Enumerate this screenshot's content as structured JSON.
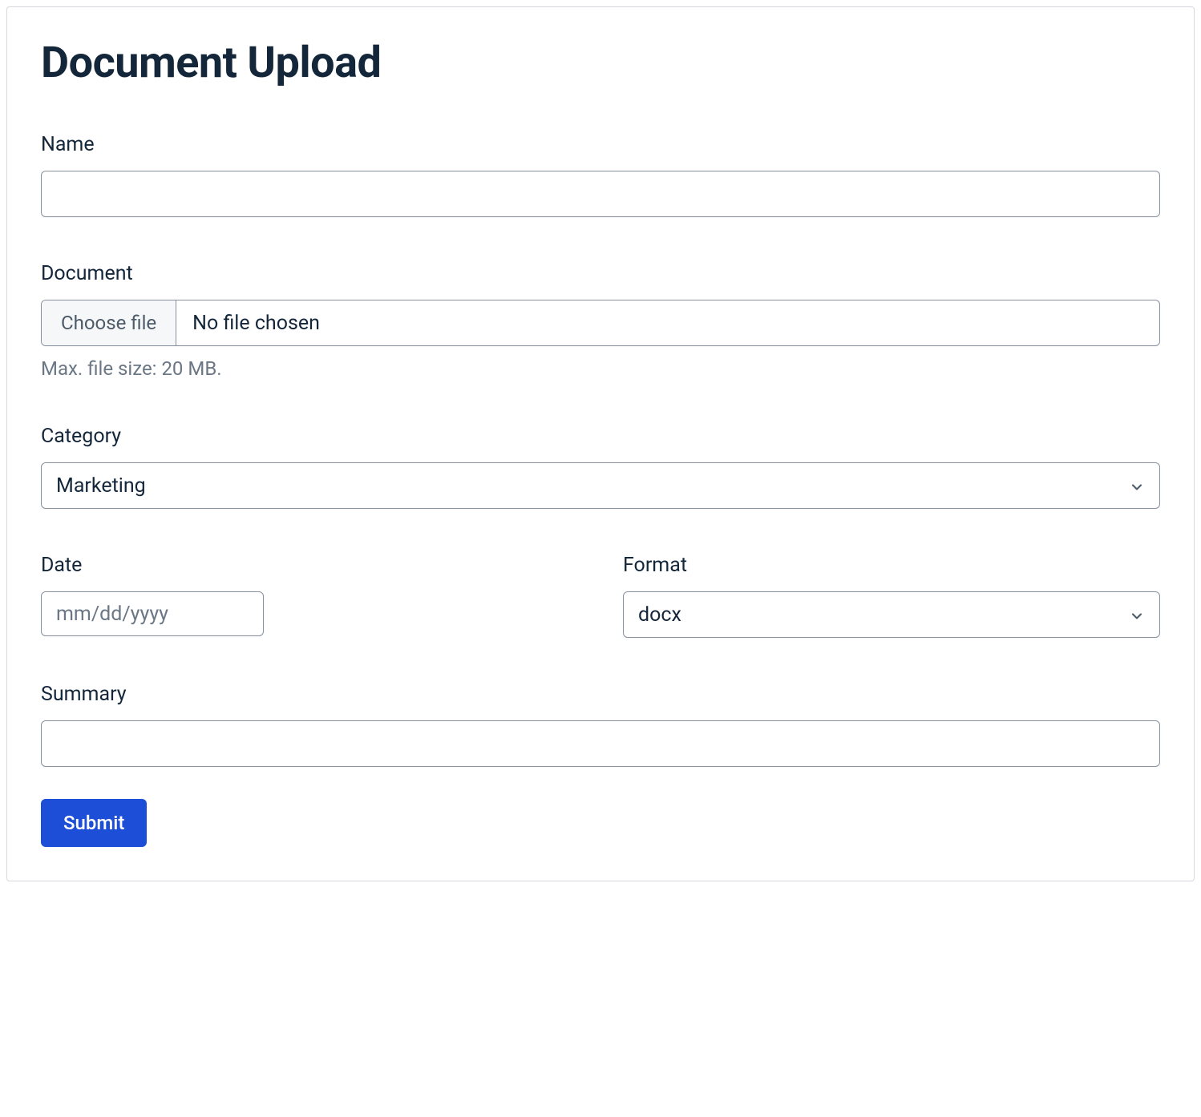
{
  "title": "Document Upload",
  "fields": {
    "name": {
      "label": "Name",
      "value": ""
    },
    "document": {
      "label": "Document",
      "choose_button": "Choose file",
      "status": "No file chosen",
      "help": "Max. file size: 20 MB."
    },
    "category": {
      "label": "Category",
      "value": "Marketing"
    },
    "date": {
      "label": "Date",
      "placeholder": "mm/dd/yyyy",
      "value": ""
    },
    "format": {
      "label": "Format",
      "value": "docx"
    },
    "summary": {
      "label": "Summary",
      "value": ""
    }
  },
  "submit_label": "Submit"
}
